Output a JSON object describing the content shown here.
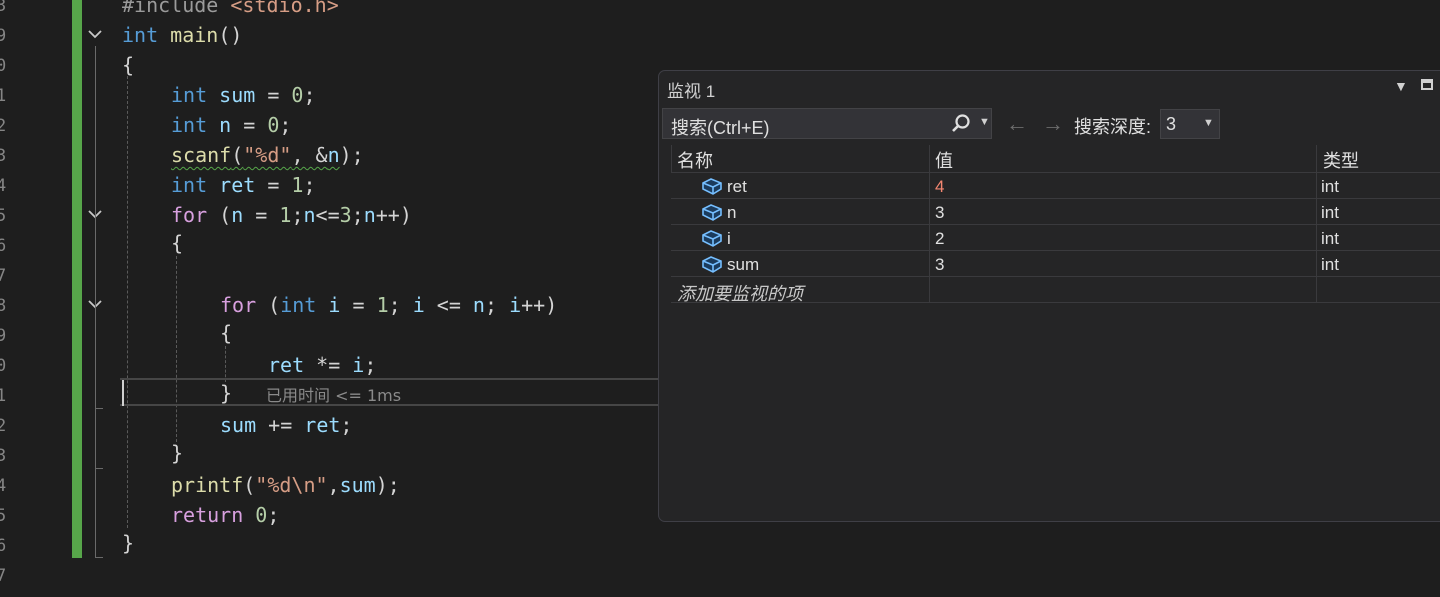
{
  "editor": {
    "line_numbers": [
      "3",
      "9",
      "0",
      "1",
      "2",
      "3",
      "4",
      "5",
      "6",
      "7",
      "8",
      "9",
      "0",
      "1",
      "2",
      "3",
      "4",
      "5",
      "6",
      "7"
    ],
    "perf_tip": "已用时间 <= 1ms",
    "code": {
      "l0": {
        "pp": "#include ",
        "hdr": "<stdio.h>"
      },
      "l1": {
        "kw": "int",
        "fn": "main",
        "rest": "()"
      },
      "l2": {
        "text": "{"
      },
      "l3": {
        "kw": "int",
        "var": "sum",
        "op": " = ",
        "num": "0",
        "end": ";"
      },
      "l4": {
        "kw": "int",
        "var": "n",
        "op": " = ",
        "num": "0",
        "end": ";"
      },
      "l5": {
        "fn": "scanf",
        "open": "(",
        "str": "\"%d\"",
        "mid": ", &",
        "var": "n",
        "end": ");"
      },
      "l6": {
        "kw": "int",
        "var": "ret",
        "op": " = ",
        "num": "1",
        "end": ";"
      },
      "l7": {
        "ctrl": "for",
        "a": " (",
        "v1": "n",
        "b": " = ",
        "n1": "1",
        "c": ";",
        "v2": "n",
        "d": "<=",
        "n2": "3",
        "e": ";",
        "v3": "n",
        "f": "++)"
      },
      "l8": {
        "text": "{"
      },
      "l9": {
        "ctrl": "for",
        "a": " (",
        "kw": "int",
        "v1": "i",
        "b": " = ",
        "n1": "1",
        "c": "; ",
        "v2": "i",
        "d": " <= ",
        "v3": "n",
        "e": "; ",
        "v4": "i",
        "f": "++)"
      },
      "l10": {
        "text": "{"
      },
      "l11": {
        "var": "ret",
        "op": " *= ",
        "var2": "i",
        "end": ";"
      },
      "l12": {
        "text": "}"
      },
      "l13": {
        "var": "sum",
        "op": " += ",
        "var2": "ret",
        "end": ";"
      },
      "l14": {
        "text": "}"
      },
      "l15": {
        "fn": "printf",
        "open": "(",
        "str": "\"%d\\n\"",
        "mid": ",",
        "var": "sum",
        "end": ");"
      },
      "l16": {
        "ctrl": "return",
        "sp": " ",
        "num": "0",
        "end": ";"
      },
      "l17": {
        "text": "}"
      }
    }
  },
  "watch": {
    "title": "监视 1",
    "search_placeholder": "搜索(Ctrl+E)",
    "depth_label": "搜索深度:",
    "depth_value": "3",
    "columns": {
      "name": "名称",
      "value": "值",
      "type": "类型"
    },
    "rows": [
      {
        "name": "ret",
        "value": "4",
        "type": "int",
        "changed": true
      },
      {
        "name": "n",
        "value": "3",
        "type": "int",
        "changed": false
      },
      {
        "name": "i",
        "value": "2",
        "type": "int",
        "changed": false
      },
      {
        "name": "sum",
        "value": "3",
        "type": "int",
        "changed": false
      }
    ],
    "add_item": "添加要监视的项",
    "icons": {
      "search": "search-icon",
      "back": "back-arrow-icon",
      "forward": "forward-arrow-icon",
      "variable": "variable-icon"
    },
    "colors": {
      "changed_value": "#f48771",
      "text": "#e0e0e0"
    }
  },
  "colors": {
    "keyword": "#569cd6",
    "control": "#d8a0df",
    "variable": "#9cdcfe",
    "function": "#dcdcaa",
    "string": "#d69d85",
    "number": "#b5cea8",
    "changes_bar": "#57a64a"
  }
}
